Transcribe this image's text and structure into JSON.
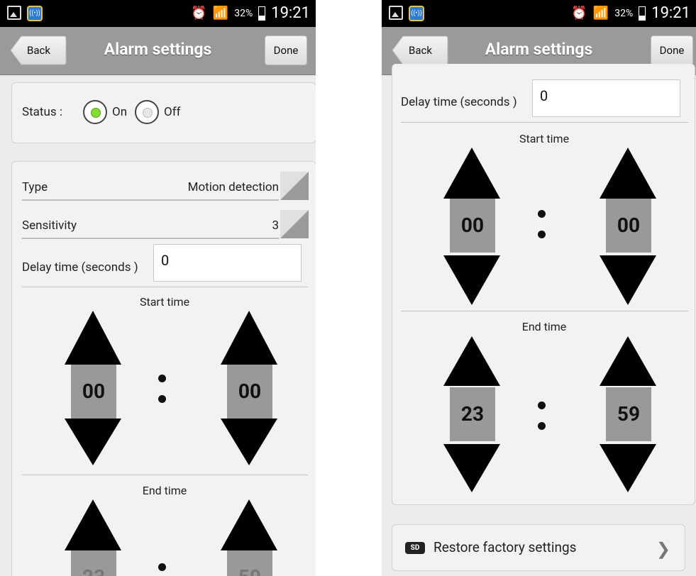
{
  "status_bar": {
    "battery": "32%",
    "time": "19:21"
  },
  "header": {
    "back_label": "Back",
    "title": "Alarm settings",
    "done_label": "Done"
  },
  "status": {
    "label": "Status :",
    "on_label": "On",
    "off_label": "Off",
    "value": "On"
  },
  "type": {
    "label": "Type",
    "value": "Motion detection"
  },
  "sensitivity": {
    "label": "Sensitivity",
    "value": "3"
  },
  "delay": {
    "label": "Delay time (seconds )",
    "value": "0"
  },
  "start_time": {
    "label": "Start time",
    "hour": "00",
    "minute": "00"
  },
  "end_time": {
    "label": "End time",
    "hour": "23",
    "minute": "59"
  },
  "restore": {
    "badge": "SD",
    "label": "Restore factory settings"
  },
  "colors": {
    "header_bg": "#9a9a9a",
    "radio_on": "#7fe02a",
    "time_box": "#999999"
  }
}
